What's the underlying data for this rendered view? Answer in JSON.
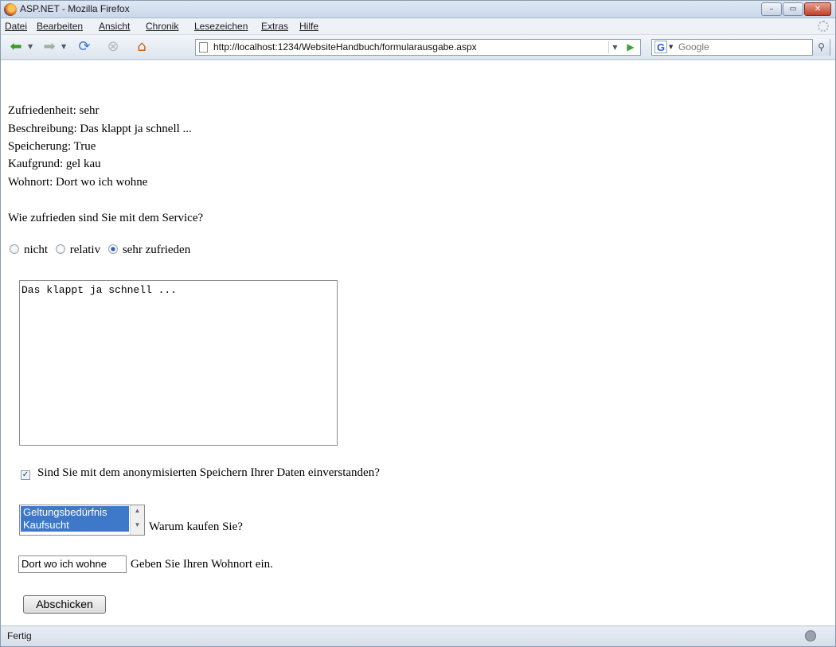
{
  "window": {
    "title": "ASP.NET - Mozilla Firefox",
    "controls": {
      "minimize": "–",
      "maximize": "▭",
      "close": "✕"
    }
  },
  "menubar": {
    "items": [
      "Datei",
      "Bearbeiten",
      "Ansicht",
      "Chronik",
      "Lesezeichen",
      "Extras",
      "Hilfe"
    ]
  },
  "toolbar": {
    "url": "http://localhost:1234/WebsiteHandbuch/formularausgabe.aspx",
    "search_placeholder": "Google",
    "icons": [
      "back-icon",
      "forward-icon",
      "reload-icon",
      "stop-icon",
      "home-icon",
      "page-icon",
      "go-icon",
      "google-icon",
      "search-icon"
    ]
  },
  "summary": [
    "Zufriedenheit: sehr",
    "Beschreibung: Das klappt ja schnell ...",
    "Speicherung: True",
    "Kaufgrund: gel kau",
    "Wohnort: Dort wo ich wohne"
  ],
  "form": {
    "question": "Wie zufrieden sind Sie mit dem Service?",
    "radio_options": [
      {
        "label": "nicht",
        "checked": false
      },
      {
        "label": "relativ",
        "checked": false
      },
      {
        "label": "sehr zufrieden",
        "checked": true
      }
    ],
    "textarea_value": "Das klappt ja schnell ...",
    "checkbox_label": "Sind Sie mit dem anonymisierten Speichern Ihrer Daten einverstanden?",
    "checkbox_checked": true,
    "listbox_items": [
      "Geltungsbedürfnis",
      "Kaufsucht"
    ],
    "listbox_caption": "Warum kaufen Sie?",
    "textbox_value": "Dort wo ich wohne",
    "textbox_caption": "Geben Sie Ihren Wohnort ein.",
    "submit_label": "Abschicken"
  },
  "statusbar": {
    "text": "Fertig"
  }
}
